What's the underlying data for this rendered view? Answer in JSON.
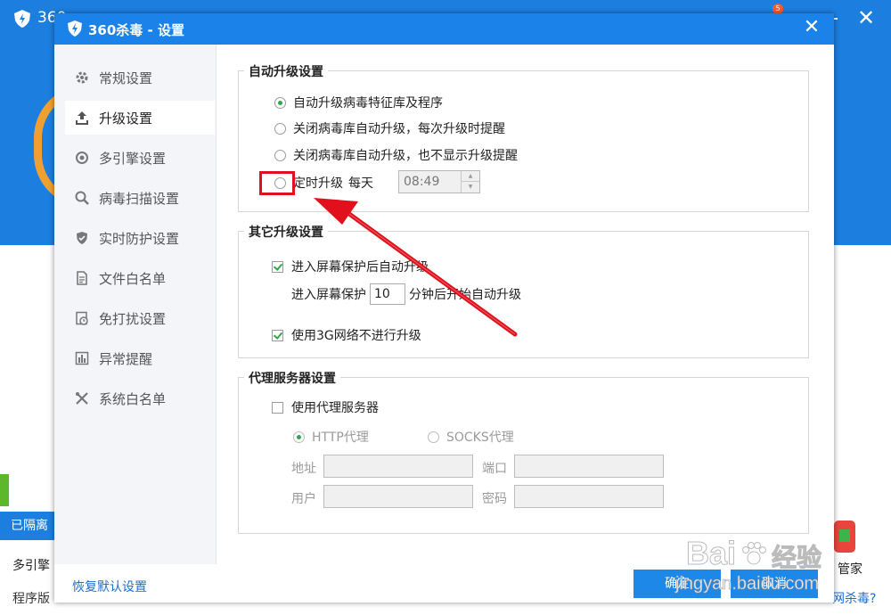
{
  "background_app": {
    "title": "360",
    "badge_count": "5",
    "quarantine_label": "已隔离",
    "engine_label": "多引擎",
    "version_label": "程序版",
    "housekeeper_label": "管家",
    "question_link": "网杀毒?"
  },
  "dialog": {
    "title": "360杀毒 - 设置",
    "close_icon": "close-icon"
  },
  "sidebar": {
    "items": [
      {
        "label": "常规设置",
        "icon": "gear-icon"
      },
      {
        "label": "升级设置",
        "icon": "upgrade-icon"
      },
      {
        "label": "多引擎设置",
        "icon": "engine-icon"
      },
      {
        "label": "病毒扫描设置",
        "icon": "search-icon"
      },
      {
        "label": "实时防护设置",
        "icon": "shield-icon"
      },
      {
        "label": "文件白名单",
        "icon": "document-icon"
      },
      {
        "label": "免打扰设置",
        "icon": "clock-icon"
      },
      {
        "label": "异常提醒",
        "icon": "chart-icon"
      },
      {
        "label": "系统白名单",
        "icon": "tools-icon"
      }
    ],
    "active_index": 1
  },
  "auto_upgrade": {
    "title": "自动升级设置",
    "options": [
      "自动升级病毒特征库及程序",
      "关闭病毒库自动升级，每次升级时提醒",
      "关闭病毒库自动升级，也不显示升级提醒",
      "定时升级"
    ],
    "selected_index": 0,
    "schedule_every_label": "每天",
    "schedule_time": "08:49"
  },
  "other_upgrade": {
    "title": "其它升级设置",
    "screensaver_upgrade": "进入屏幕保护后自动升级",
    "screensaver_prefix": "进入屏幕保护",
    "screensaver_minutes": "10",
    "screensaver_suffix": "分钟后开始自动升级",
    "no_3g_upgrade": "使用3G网络不进行升级"
  },
  "proxy": {
    "title": "代理服务器设置",
    "use_proxy": "使用代理服务器",
    "http_proxy": "HTTP代理",
    "socks_proxy": "SOCKS代理",
    "address_label": "地址",
    "port_label": "端口",
    "user_label": "用户",
    "password_label": "密码"
  },
  "footer": {
    "restore_defaults": "恢复默认设置",
    "ok": "确定",
    "cancel": "取消"
  },
  "watermark": {
    "brand": "Bai",
    "brand2": "经验",
    "url": "jingyan.baidu.com"
  },
  "colors": {
    "title_blue": "#1a82e8",
    "check_green": "#2ea84a",
    "highlight_red": "#e0101c"
  }
}
